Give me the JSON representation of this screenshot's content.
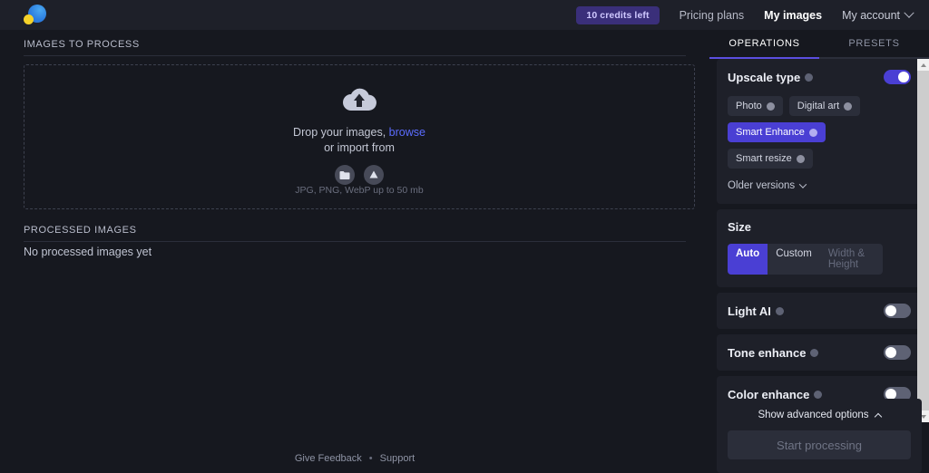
{
  "topbar": {
    "logo_name": "app-logo",
    "credits_badge": "10 credits left",
    "links": [
      {
        "label": "Pricing plans",
        "active": false
      },
      {
        "label": "My images",
        "active": true
      }
    ],
    "account_label": "My account"
  },
  "main": {
    "images_to_process_heading": "IMAGES TO PROCESS",
    "dropzone": {
      "line1_prefix": "Drop your images, ",
      "browse_label": "browse",
      "line2": "or import from",
      "import_sources": [
        "folder-icon",
        "google-drive-icon"
      ],
      "note": "JPG, PNG, WebP up to 50 mb"
    },
    "processed_images_heading": "PROCESSED IMAGES",
    "empty_state": "No processed images yet"
  },
  "footer": {
    "feedback": "Give Feedback",
    "separator": "•",
    "support": "Support"
  },
  "panel": {
    "tabs": [
      {
        "label": "OPERATIONS",
        "active": true
      },
      {
        "label": "PRESETS",
        "active": false
      }
    ],
    "upscale_type": {
      "label": "Upscale type",
      "toggle_state": "on",
      "chips": [
        {
          "label": "Photo",
          "selected": false
        },
        {
          "label": "Digital art",
          "selected": false
        },
        {
          "label": "Smart Enhance",
          "selected": true
        },
        {
          "label": "Smart resize",
          "selected": false
        }
      ],
      "older_versions_label": "Older versions"
    },
    "size": {
      "label": "Size",
      "options": [
        {
          "label": "Auto",
          "selected": true,
          "placeholder": false
        },
        {
          "label": "Custom",
          "selected": false,
          "placeholder": false
        },
        {
          "label": "Width & Height",
          "selected": false,
          "placeholder": true
        }
      ]
    },
    "toggles": [
      {
        "label": "Light AI",
        "state": "off"
      },
      {
        "label": "Tone enhance",
        "state": "off"
      },
      {
        "label": "Color enhance",
        "state": "off"
      }
    ],
    "advanced_label": "Show advanced options",
    "start_button": "Start processing"
  },
  "colors": {
    "accent": "#4a3fd4",
    "tab_accent": "#5b4fe0",
    "link": "#5b6cff",
    "panel_bg": "#1e2029",
    "page_bg": "#16181f"
  }
}
